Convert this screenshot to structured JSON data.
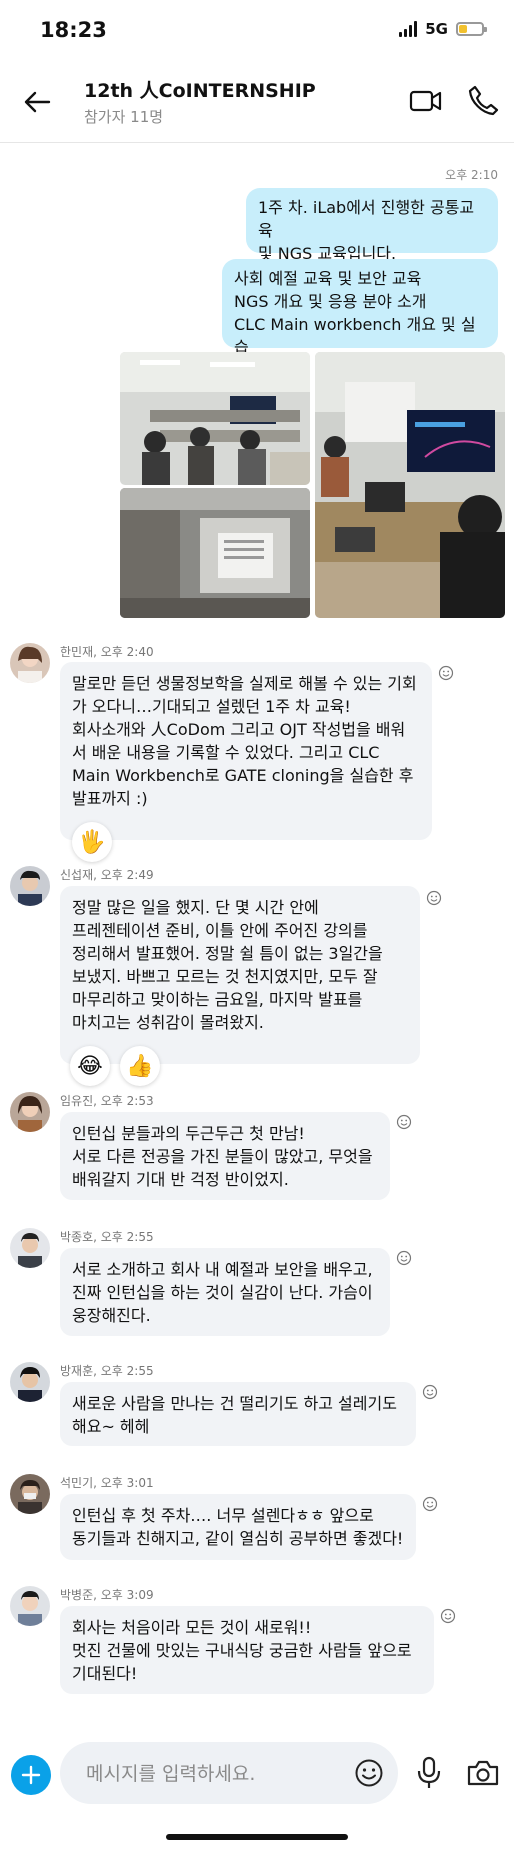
{
  "status_bar": {
    "time": "18:23",
    "network": "5G"
  },
  "header": {
    "title": "12th 人CoINTERNSHIP",
    "subtitle": "참가자 11명"
  },
  "outgoing": {
    "timestamp": "오후 2:10",
    "bubble1": [
      "1주 차. iLab에서 진행한 공통교육",
      "및 NGS 교육입니다."
    ],
    "bubble2": [
      "사회 예절 교육 및 보안 교육",
      "NGS 개요 및 응용 분야 소개",
      "CLC Main workbench 개요 및 실습"
    ]
  },
  "messages": [
    {
      "sender": "한민재, 오후 2:40",
      "lines": [
        "말로만 듣던 생물정보학을 실제로 해볼 수 있는 기회",
        "가 오다니…기대되고 설렜던 1주 차 교육!",
        "회사소개와 人CoDom 그리고 OJT 작성법을 배워",
        "서 배운 내용을 기록할 수 있었다. 그리고 CLC",
        "Main Workbench로 GATE cloning을 실습한 후",
        "발표까지 :)"
      ],
      "reactions": [
        "🖐"
      ]
    },
    {
      "sender": "신섭재, 오후 2:49",
      "lines": [
        "정말 많은 일을 했지. 단 몇 시간 안에",
        "프레젠테이션 준비, 이틀 안에 주어진 강의를",
        "정리해서 발표했어. 정말 쉴 틈이 없는 3일간을",
        "보냈지. 바쁘고 모르는 것 천지였지만, 모두 잘",
        "마무리하고 맞이하는 금요일, 마지막 발표를",
        "마치고는 성취감이 몰려왔지."
      ],
      "reactions": [
        "😂",
        "👍"
      ]
    },
    {
      "sender": "임유진, 오후 2:53",
      "lines": [
        "인턴십 분들과의 두근두근 첫 만남!",
        "서로 다른 전공을 가진 분들이 많았고, 무엇을",
        "배워갈지 기대 반 걱정 반이었지."
      ]
    },
    {
      "sender": "박종호, 오후 2:55",
      "lines": [
        "서로 소개하고 회사 내 예절과 보안을 배우고,",
        "진짜 인턴십을 하는 것이 실감이 난다. 가슴이",
        "웅장해진다."
      ]
    },
    {
      "sender": "방재훈, 오후 2:55",
      "lines": [
        "새로운 사람을 만나는 건 떨리기도 하고 설레기도",
        "해요~ 헤헤"
      ]
    },
    {
      "sender": "석민기, 오후 3:01",
      "lines": [
        "인턴십 후 첫 주차…. 너무 설렌다ㅎㅎ 앞으로",
        "동기들과 친해지고, 같이 열심히 공부하면 좋겠다!"
      ]
    },
    {
      "sender": "박병준, 오후 3:09",
      "lines": [
        "회사는 처음이라 모든 것이 새로워!!",
        "멋진 건물에 맛있는 구내식당 궁금한 사람들 앞으로",
        "기대된다!"
      ]
    }
  ],
  "input": {
    "placeholder": "메시지를 입력하세요."
  },
  "icons": {
    "back": "arrow-left-icon",
    "video": "video-camera-icon",
    "call": "phone-icon",
    "add": "plus-icon",
    "emoji": "smiley-icon",
    "mic": "microphone-icon",
    "camera": "camera-icon",
    "react": "add-reaction-icon"
  },
  "colors": {
    "accent": "#0aa1e8",
    "outgoing_bubble": "#c8eefb",
    "incoming_bubble": "#f1f3f6",
    "battery": "#f2c12e"
  }
}
